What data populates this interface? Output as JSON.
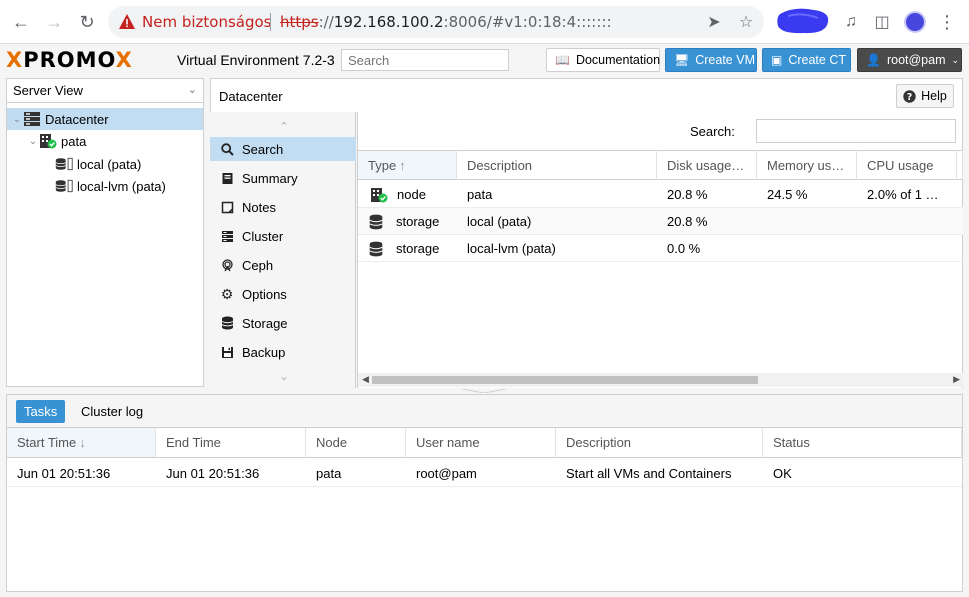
{
  "browser": {
    "security_label": "Nem biztonságos",
    "url_scheme": "https",
    "url_scheme_suffix": "://",
    "url_host": "192.168.100.2",
    "url_rest": ":8006/#v1:0:18:4:::::::",
    "icons": [
      "back-icon",
      "forward-icon",
      "reload-icon",
      "warning-icon",
      "send-icon",
      "star-icon",
      "media-icon",
      "sidepanel-icon",
      "profile-icon",
      "menu-icon"
    ]
  },
  "header": {
    "logo_left": "PRO",
    "logo_x1": "X",
    "logo_mid": "MO",
    "logo_x2": "X",
    "version": "Virtual Environment 7.2-3",
    "search_placeholder": "Search",
    "documentation": "Documentation",
    "create_vm": "Create VM",
    "create_ct": "Create CT",
    "user": "root@pam",
    "accent": "#3892d4",
    "logo_accent": "#e57000"
  },
  "tree": {
    "view": "Server View",
    "items": [
      {
        "label": "Datacenter",
        "level": 0,
        "icon": "datacenter-icon",
        "selected": true
      },
      {
        "label": "pata",
        "level": 1,
        "icon": "node-online-icon"
      },
      {
        "label": "local (pata)",
        "level": 2,
        "icon": "storage-icon"
      },
      {
        "label": "local-lvm (pata)",
        "level": 2,
        "icon": "storage-icon"
      }
    ]
  },
  "content": {
    "title": "Datacenter",
    "help": "Help",
    "nav": [
      {
        "label": "Search",
        "icon": "search-icon",
        "selected": true
      },
      {
        "label": "Summary",
        "icon": "book-icon"
      },
      {
        "label": "Notes",
        "icon": "notes-icon"
      },
      {
        "label": "Cluster",
        "icon": "cluster-icon"
      },
      {
        "label": "Ceph",
        "icon": "ceph-icon"
      },
      {
        "label": "Options",
        "icon": "gear-icon"
      },
      {
        "label": "Storage",
        "icon": "database-icon"
      },
      {
        "label": "Backup",
        "icon": "backup-icon"
      }
    ]
  },
  "grid": {
    "search_label": "Search:",
    "columns": [
      "Type",
      "Description",
      "Disk usage…",
      "Memory us…",
      "CPU usage"
    ],
    "rows": [
      {
        "type": "node",
        "description": "pata",
        "disk": "20.8 %",
        "memory": "24.5 %",
        "cpu": "2.0% of 1 …"
      },
      {
        "type": "storage",
        "description": "local (pata)",
        "disk": "20.8 %",
        "memory": "",
        "cpu": ""
      },
      {
        "type": "storage",
        "description": "local-lvm (pata)",
        "disk": "0.0 %",
        "memory": "",
        "cpu": ""
      }
    ]
  },
  "log": {
    "tabs": [
      "Tasks",
      "Cluster log"
    ],
    "columns": [
      "Start Time",
      "End Time",
      "Node",
      "User name",
      "Description",
      "Status"
    ],
    "rows": [
      {
        "start": "Jun 01 20:51:36",
        "end": "Jun 01 20:51:36",
        "node": "pata",
        "user": "root@pam",
        "description": "Start all VMs and Containers",
        "status": "OK"
      }
    ]
  }
}
